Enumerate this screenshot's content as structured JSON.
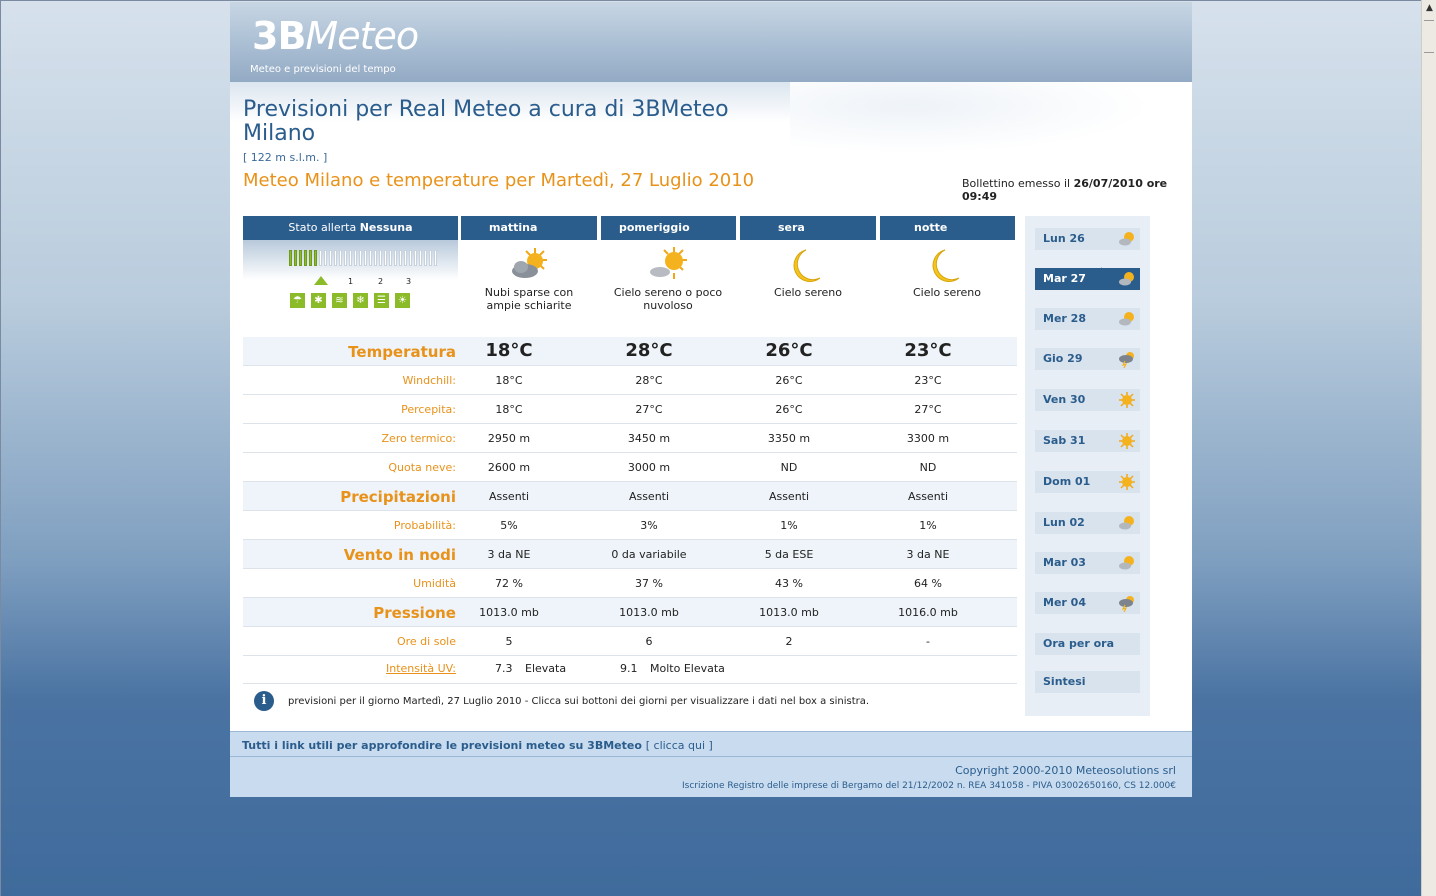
{
  "header": {
    "logo_bold": "3B",
    "logo_rest": "Meteo",
    "tagline": "Meteo e previsioni del tempo"
  },
  "title": {
    "line1": "Previsioni per Real Meteo a cura di 3BMeteo",
    "line2": "Milano",
    "altitude": "[ 122 m s.l.m. ]",
    "subtitle": "Meteo Milano e temperature per Martedì, 27 Luglio 2010",
    "bulletin_prefix": "Bollettino emesso il",
    "bulletin_date": "26/07/2010 ore 09:49"
  },
  "alert": {
    "label": "Stato allerta",
    "value": "Nessuna",
    "scale": [
      "1",
      "2",
      "3"
    ],
    "icons": [
      "rain-icon",
      "sun-icon",
      "wind-icon",
      "snow-icon",
      "fog-icon",
      "heat-icon"
    ],
    "accent_color": "#8cbb2a"
  },
  "periods": [
    {
      "name": "mattina",
      "desc_line1": "Nubi sparse con",
      "desc_line2": "ampie schiarite",
      "icon": "sun-cloud-icon"
    },
    {
      "name": "pomeriggio",
      "desc_line1": "Cielo sereno o poco",
      "desc_line2": "nuvoloso",
      "icon": "sun-cloud-icon"
    },
    {
      "name": "sera",
      "desc_line1": "Cielo sereno",
      "desc_line2": "",
      "icon": "moon-icon"
    },
    {
      "name": "notte",
      "desc_line1": "Cielo sereno",
      "desc_line2": "",
      "icon": "moon-icon"
    }
  ],
  "rows": [
    {
      "label": "Temperatura",
      "big": true,
      "alt": true,
      "values": [
        "18°C",
        "28°C",
        "26°C",
        "23°C"
      ]
    },
    {
      "label": "Windchill:",
      "big": false,
      "alt": false,
      "values": [
        "18°C",
        "28°C",
        "26°C",
        "23°C"
      ]
    },
    {
      "label": "Percepita:",
      "big": false,
      "alt": false,
      "values": [
        "18°C",
        "27°C",
        "26°C",
        "27°C"
      ]
    },
    {
      "label": "Zero termico:",
      "big": false,
      "alt": false,
      "values": [
        "2950 m",
        "3450 m",
        "3350 m",
        "3300 m"
      ]
    },
    {
      "label": "Quota neve:",
      "big": false,
      "alt": false,
      "values": [
        "2600 m",
        "3000 m",
        "ND",
        "ND"
      ]
    },
    {
      "label": "Precipitazioni",
      "big": true,
      "alt": true,
      "values": [
        "Assenti",
        "Assenti",
        "Assenti",
        "Assenti"
      ]
    },
    {
      "label": "Probabilità:",
      "big": false,
      "alt": false,
      "values": [
        "5%",
        "3%",
        "1%",
        "1%"
      ]
    },
    {
      "label": "Vento in nodi",
      "big": true,
      "alt": true,
      "values": [
        "3 da NE",
        "0 da variabile",
        "5 da ESE",
        "3 da NE"
      ]
    },
    {
      "label": "Umidità",
      "big": false,
      "alt": false,
      "values": [
        "72 %",
        "37 %",
        "43 %",
        "64 %"
      ]
    },
    {
      "label": "Pressione",
      "big": true,
      "alt": true,
      "values": [
        "1013.0 mb",
        "1013.0 mb",
        "1013.0 mb",
        "1016.0 mb"
      ]
    },
    {
      "label": "Ore di sole",
      "big": false,
      "alt": false,
      "values": [
        "5",
        "6",
        "2",
        "-"
      ]
    }
  ],
  "uv": {
    "label": "Intensità UV:",
    "entries": [
      {
        "value": "7.3",
        "level": "Elevata"
      },
      {
        "value": "9.1",
        "level": "Molto Elevata"
      }
    ]
  },
  "info_text": "previsioni per il giorno Martedì, 27 Luglio 2010 - Clicca sui bottoni dei giorni per visualizzare i dati nel box a sinistra.",
  "days": [
    {
      "label": "Lun 26",
      "icon": "sun-cloud-icon"
    },
    {
      "label": "Mar 27",
      "icon": "sun-cloud-icon",
      "active": true
    },
    {
      "label": "Mer 28",
      "icon": "sun-cloud-icon"
    },
    {
      "label": "Gio 29",
      "icon": "thunder-icon"
    },
    {
      "label": "Ven 30",
      "icon": "sun-icon"
    },
    {
      "label": "Sab 31",
      "icon": "sun-icon"
    },
    {
      "label": "Dom 01",
      "icon": "sun-icon"
    },
    {
      "label": "Lun 02",
      "icon": "sun-cloud-icon"
    },
    {
      "label": "Mar 03",
      "icon": "sun-cloud-icon"
    },
    {
      "label": "Mer 04",
      "icon": "thunder-icon"
    }
  ],
  "day_links": {
    "hourly": "Ora per ora",
    "summary": "Sintesi"
  },
  "links_bar": {
    "text": "Tutti i link utili per approfondire le previsioni meteo su 3BMeteo",
    "click": "[ clicca qui ]"
  },
  "footer": {
    "copyright": "Copyright 2000-2010 Meteosolutions srl",
    "registry": "Iscrizione Registro delle imprese di Bergamo del 21/12/2002 n. REA 341058 - PIVA 03002650160, CS 12.000€"
  },
  "colors": {
    "brand": "#2a5c8c",
    "accent": "#e8921a"
  }
}
